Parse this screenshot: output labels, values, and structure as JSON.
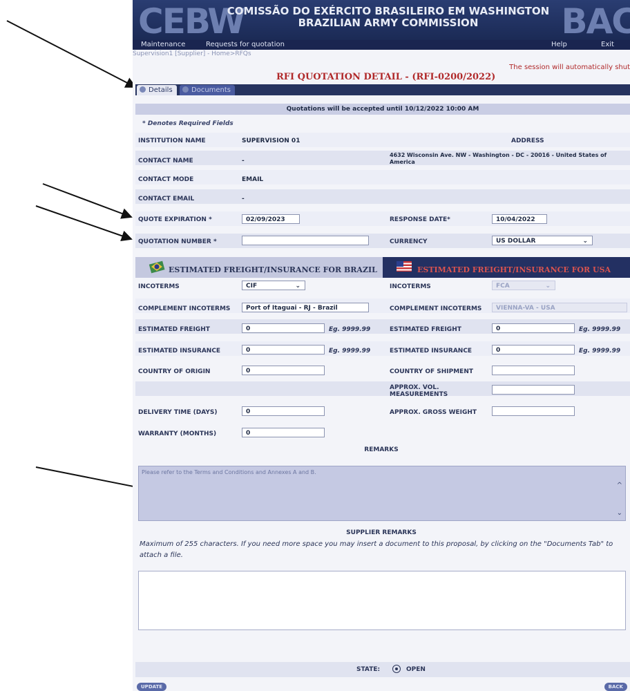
{
  "header": {
    "logo_left": "CEBW",
    "logo_right": "BAC",
    "title_line1": "COMISSÃO DO EXÉRCITO BRASILEIRO EM WASHINGTON",
    "title_line2": "BRAZILIAN ARMY COMMISSION"
  },
  "menu": {
    "maintenance": "Maintenance",
    "requests": "Requests for quotation",
    "help": "Help",
    "exit": "Exit"
  },
  "breadcrumb": "Supervision1 [Supplier] - Home>RFQs",
  "session_notice": "The session will automatically shut",
  "page_title": "RFI QUOTATION DETAIL - (RFI-0200/2022)",
  "tabs": {
    "details": "Details",
    "documents": "Documents"
  },
  "notice": "Quotations will be accepted until 10/12/2022 10:00 AM",
  "required_note": "* Denotes Required Fields",
  "fields": {
    "institution_name_label": "INSTITUTION NAME",
    "institution_name": "SUPERVISION 01",
    "address_label": "ADDRESS",
    "address": "4632 Wisconsin Ave. NW - Washington - DC - 20016 - United States of America",
    "contact_name_label": "CONTACT NAME",
    "contact_name": "-",
    "contact_mode_label": "CONTACT MODE",
    "contact_mode": "EMAIL",
    "contact_email_label": "CONTACT EMAIL",
    "contact_email": "-",
    "quote_expiration_label": "QUOTE EXPIRATION *",
    "quote_expiration": "02/09/2023",
    "response_date_label": "RESPONSE DATE*",
    "response_date": "10/04/2022",
    "quotation_number_label": "QUOTATION NUMBER *",
    "quotation_number": "",
    "currency_label": "CURRENCY",
    "currency": "US DOLLAR"
  },
  "brazil": {
    "title": "ESTIMATED FREIGHT/INSURANCE FOR BRAZIL",
    "incoterms_label": "INCOTERMS",
    "incoterms": "CIF",
    "complement_label": "COMPLEMENT INCOTERMS",
    "complement": "Port of Itaguai - RJ - Brazil",
    "freight_label": "ESTIMATED FREIGHT",
    "freight": "0",
    "insurance_label": "ESTIMATED INSURANCE",
    "insurance": "0",
    "origin_label": "COUNTRY OF ORIGIN",
    "origin": "0",
    "delivery_label": "DELIVERY TIME (DAYS)",
    "delivery": "0",
    "warranty_label": "WARRANTY (MONTHS)",
    "warranty": "0",
    "hint": "Eg. 9999.99"
  },
  "usa": {
    "title": "ESTIMATED FREIGHT/INSURANCE FOR USA",
    "incoterms_label": "INCOTERMS",
    "incoterms": "FCA",
    "complement_label": "COMPLEMENT INCOTERMS",
    "complement": "VIENNA-VA - USA",
    "freight_label": "ESTIMATED FREIGHT",
    "freight": "0",
    "insurance_label": "ESTIMATED INSURANCE",
    "insurance": "0",
    "shipment_label": "COUNTRY OF SHIPMENT",
    "vol_label_1": "APPROX. VOL.",
    "vol_label_2": "MEASUREMENTS",
    "weight_label": "APPROX. GROSS WEIGHT",
    "hint": "Eg. 9999.99"
  },
  "remarks": {
    "heading": "REMARKS",
    "text": "Please refer to the Terms and Conditions and Annexes A and B."
  },
  "supplier_remarks": {
    "heading": "SUPPLIER REMARKS",
    "note": "Maximum of 255 characters. If you need more space you may insert a document to this proposal, by clicking on the \"Documents Tab\" to attach a file."
  },
  "state": {
    "label": "STATE:",
    "value": "OPEN"
  },
  "buttons": {
    "update": "UPDATE",
    "back": "BACK"
  },
  "icons": {
    "tab_details": "details-tab-icon",
    "tab_documents": "documents-tab-icon",
    "brazil_flag": "brazil-flag-icon",
    "usa_flag": "usa-flag-icon"
  }
}
